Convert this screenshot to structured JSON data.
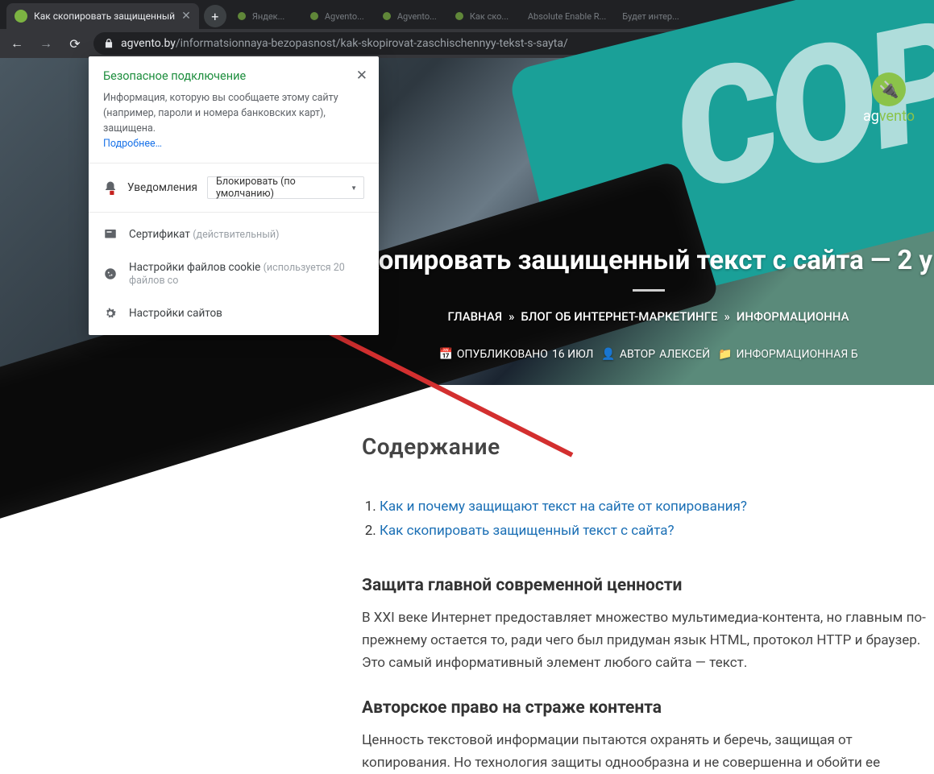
{
  "browser": {
    "tab_title": "Как скопировать защищенный",
    "newtab_tooltip": "+",
    "url_host": "agvento.by",
    "url_path": "/informatsionnaya-bezopasnost/kak-skopirovat-zaschischennyy-tekst-s-sayta/",
    "inactive_tabs": [
      "Яндек...",
      "Agvento...",
      "Agvento...",
      "Как ско...",
      "Absolute Enable R...",
      "Будет интер..."
    ]
  },
  "popup": {
    "title": "Безопасное подключение",
    "desc": "Информация, которую вы сообщаете этому сайту (например, пароли и номера банковских карт), защищена.",
    "more": "Подробнее…",
    "perm_label": "Уведомления",
    "perm_value": "Блокировать (по умолчанию)",
    "cert_label": "Сертификат",
    "cert_status": "(действительный)",
    "cookie_label": "Настройки файлов cookie",
    "cookie_status": "(используется 20 файлов co",
    "site_settings": "Настройки сайтов"
  },
  "logo": {
    "brand_a": "ag",
    "brand_b": "vento"
  },
  "hero": {
    "title": "копировать защищенный текст с сайта — 2 у",
    "crumbs": {
      "a": "ГЛАВНАЯ",
      "s1": "»",
      "b": "БЛОГ ОБ ИНТЕРНЕТ-МАРКЕТИНГЕ",
      "s2": "»",
      "c": "ИНФОРМАЦИОННА"
    },
    "meta": {
      "pub_label": "ОПУБЛИКОВАНО",
      "pub_value": "16 ИЮЛ",
      "author_label": "АВТОР",
      "author_value": "АЛЕКСЕЙ",
      "cat_value": "ИНФОРМАЦИОННАЯ Б"
    }
  },
  "content": {
    "toc_title": "Содержание",
    "toc": [
      "Как и почему защищают текст на сайте от копирования?",
      "Как скопировать защищенный текст с сайта?"
    ],
    "h3a": "Защита главной современной ценности",
    "p1": "В XXI веке Интернет предоставляет множество мультимедиа-контента, но главным по-прежнему остается то, ради чего был придуман язык HTML, протокол HTTP и браузер. Это самый информативный элемент любого сайта — текст.",
    "h3b": "Авторское право на страже контента",
    "p2": "Ценность текстовой информации пытаются охранять и беречь, защищая от копирования. Но технология защиты однообразна и не совершенна и обойти ее"
  }
}
